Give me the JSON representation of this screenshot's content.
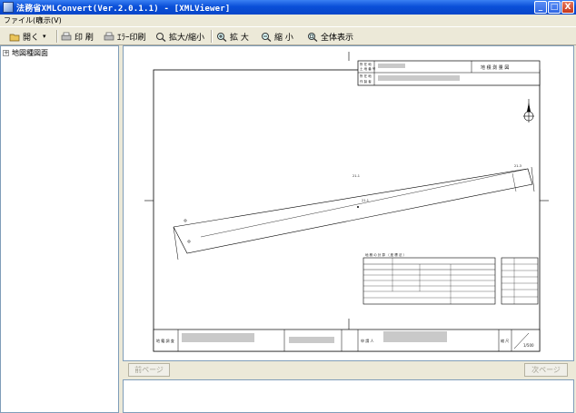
{
  "window": {
    "title": "法務省XMLConvert(Ver.2.0.1.1) - [XMLViewer]",
    "controls": {
      "minimize": "_",
      "maximize": "□",
      "close": "X"
    }
  },
  "menu": [
    "ファイル(F)",
    "表示(V)"
  ],
  "toolbar": {
    "open": "開く",
    "print": "印 刷",
    "error_print": "ｴﾗｰ印刷",
    "zoom_toggle": "拡大/縮小",
    "zoom_in": "拡 大",
    "zoom_out": "縮 小",
    "fit_all": "全体表示"
  },
  "tree": {
    "root_label": "地図種図面"
  },
  "nav": {
    "prev": "前ページ",
    "next": "次ページ"
  },
  "document": {
    "header_labels": {
      "row1a": "所 在 地",
      "row1b": "土 地 番 号",
      "row2a": "所 在 地",
      "row2b": "作 製 者"
    },
    "header_right": "地 積 測 量 図",
    "parcel_labels": {
      "main": "21-1",
      "upper": "21-1",
      "right": "21-3"
    },
    "table_title": "地 積 の 計 算 （ 座 標 法 ）",
    "footer": {
      "left_label": "地 籍 調 査",
      "middle_label": "申 請 人",
      "right_label": "縮 尺",
      "scale": "1/500"
    }
  },
  "icons": [
    "open-icon",
    "print-icon",
    "error-print-icon",
    "zoom-toggle-icon",
    "zoom-in-icon",
    "zoom-out-icon",
    "fit-all-icon"
  ]
}
